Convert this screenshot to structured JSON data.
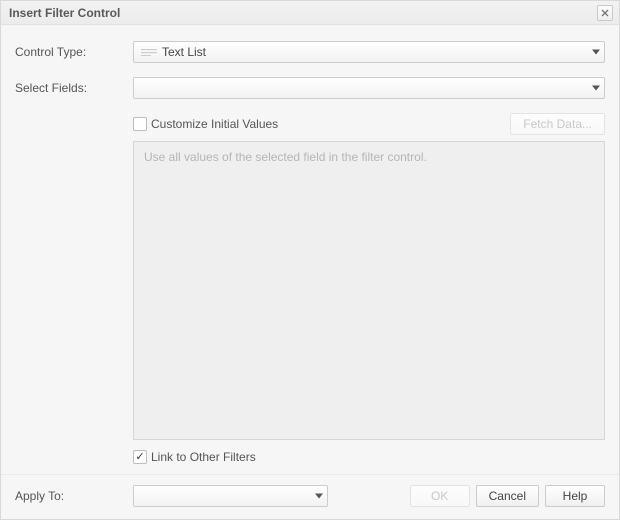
{
  "dialog": {
    "title": "Insert Filter Control"
  },
  "labels": {
    "control_type": "Control Type:",
    "select_fields": "Select Fields:",
    "apply_to": "Apply To:"
  },
  "control_type": {
    "selected": "Text List"
  },
  "select_fields": {
    "selected": ""
  },
  "customize": {
    "checked": false,
    "label": "Customize Initial Values"
  },
  "fetch_button": {
    "label": "Fetch Data...",
    "enabled": false
  },
  "values_area": {
    "placeholder": "Use all values of the selected field in the filter control."
  },
  "link_filters": {
    "checked": true,
    "label": "Link to Other Filters"
  },
  "apply_to": {
    "selected": ""
  },
  "buttons": {
    "ok": "OK",
    "cancel": "Cancel",
    "help": "Help"
  },
  "ok_enabled": false
}
